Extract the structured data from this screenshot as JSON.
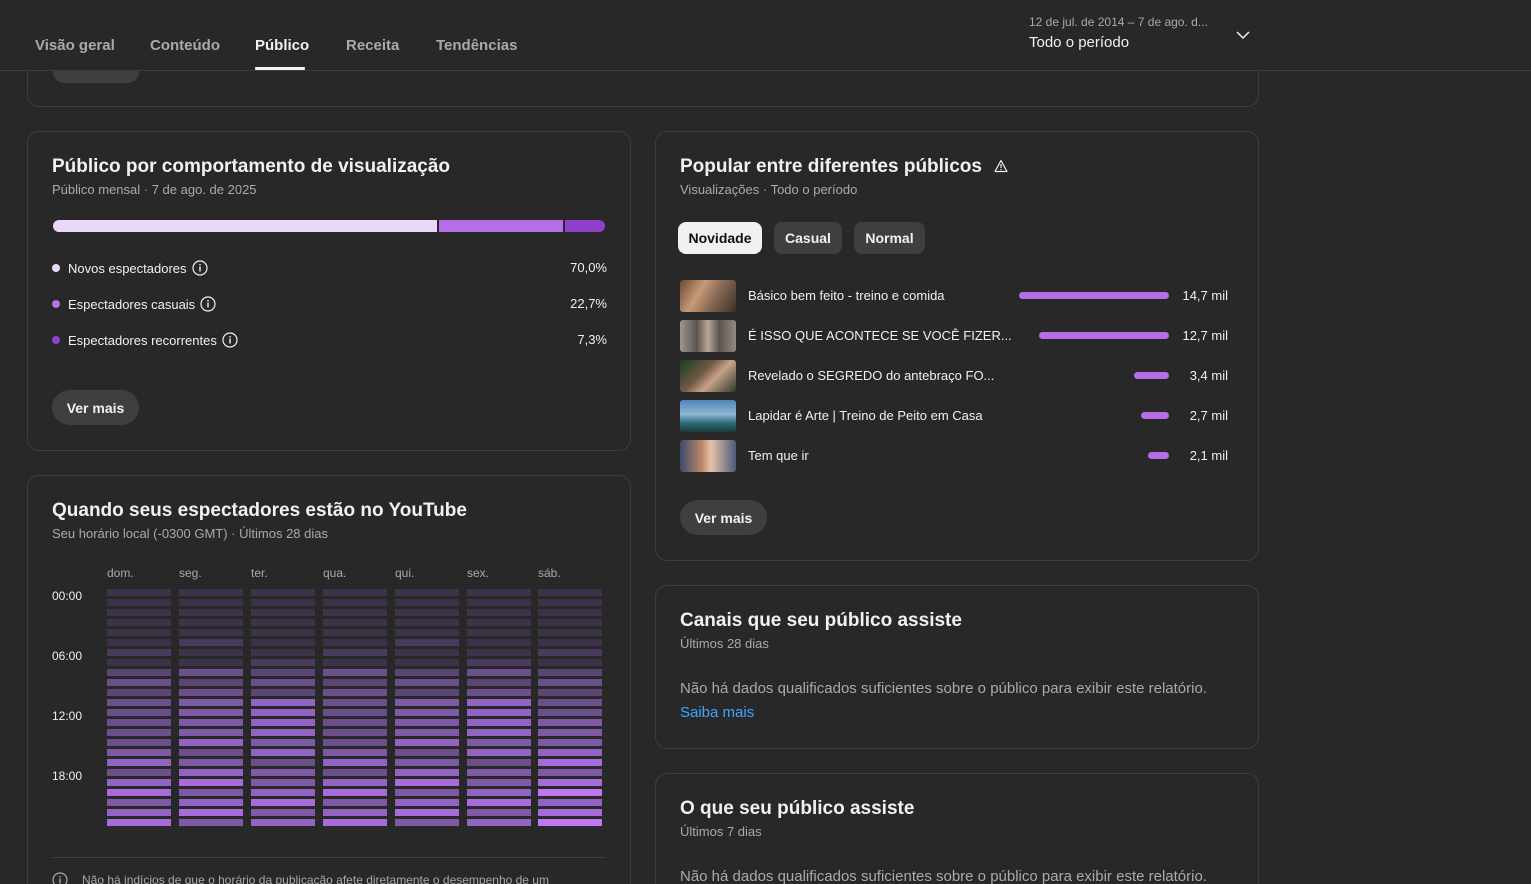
{
  "nav": {
    "tabs": [
      {
        "label": "Visão geral"
      },
      {
        "label": "Conteúdo"
      },
      {
        "label": "Público"
      },
      {
        "label": "Receita"
      },
      {
        "label": "Tendências"
      }
    ],
    "date_range": "12 de jul. de 2014 – 7 de ago. d...",
    "period": "Todo o período"
  },
  "behavior": {
    "title": "Público por comportamento de visualização",
    "subtitle": "Público mensal · 7 de ago. de 2025",
    "segments": [
      {
        "label": "Novos espectadores",
        "value": "70,0%",
        "share": 70.0,
        "color": "#ead8f6"
      },
      {
        "label": "Espectadores casuais",
        "value": "22,7%",
        "share": 22.7,
        "color": "#b56ee8"
      },
      {
        "label": "Espectadores recorrentes",
        "value": "7,3%",
        "share": 7.3,
        "color": "#8f3fc9"
      }
    ],
    "see_more": "Ver mais"
  },
  "when": {
    "title": "Quando seus espectadores estão no YouTube",
    "subtitle": "Seu horário local (-0300 GMT) · Últimos 28 dias",
    "days": [
      "dom.",
      "seg.",
      "ter.",
      "qua.",
      "qui.",
      "sex.",
      "sáb."
    ],
    "hours": [
      "00:00",
      "06:00",
      "12:00",
      "18:00"
    ],
    "note": "Não há indícios de que o horário da publicação afete diretamente o desempenho de um"
  },
  "popular": {
    "title": "Popular entre diferentes públicos",
    "subtitle": "Visualizações · Todo o período",
    "chips": [
      "Novidade",
      "Casual",
      "Normal"
    ],
    "videos": [
      {
        "title": "Básico bem feito - treino e comida",
        "value": "14,7 mil",
        "views": 14.7
      },
      {
        "title": "É ISSO QUE ACONTECE SE VOCÊ FIZER...",
        "value": "12,7 mil",
        "views": 12.7
      },
      {
        "title": "Revelado o SEGREDO do antebraço FO...",
        "value": "3,4 mil",
        "views": 3.4
      },
      {
        "title": "Lapidar é Arte | Treino de Peito em Casa",
        "value": "2,7 mil",
        "views": 2.7
      },
      {
        "title": "Tem que ir",
        "value": "2,1 mil",
        "views": 2.1
      }
    ],
    "see_more": "Ver mais"
  },
  "channels": {
    "title": "Canais que seu público assiste",
    "subtitle": "Últimos 28 dias",
    "empty_text": "Não há dados qualificados suficientes sobre o público para exibir este relatório.",
    "learn_more": "Saiba mais"
  },
  "watches": {
    "title": "O que seu público assiste",
    "subtitle": "Últimos 7 dias",
    "empty_text": "Não há dados qualificados suficientes sobre o público para exibir este relatório."
  }
}
